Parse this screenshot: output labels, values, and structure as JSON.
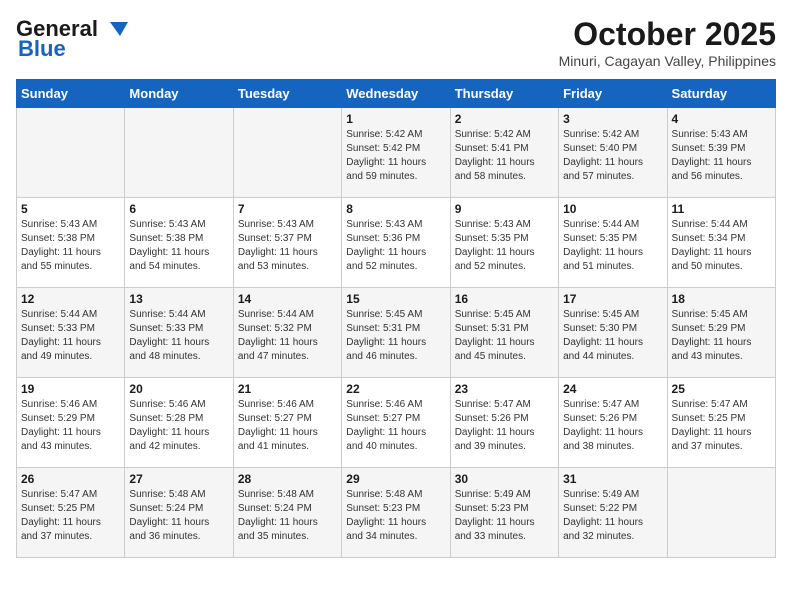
{
  "header": {
    "logo_line1": "General",
    "logo_line2": "Blue",
    "month": "October 2025",
    "location": "Minuri, Cagayan Valley, Philippines"
  },
  "columns": [
    "Sunday",
    "Monday",
    "Tuesday",
    "Wednesday",
    "Thursday",
    "Friday",
    "Saturday"
  ],
  "weeks": [
    [
      {
        "day": "",
        "info": ""
      },
      {
        "day": "",
        "info": ""
      },
      {
        "day": "",
        "info": ""
      },
      {
        "day": "1",
        "info": "Sunrise: 5:42 AM\nSunset: 5:42 PM\nDaylight: 11 hours\nand 59 minutes."
      },
      {
        "day": "2",
        "info": "Sunrise: 5:42 AM\nSunset: 5:41 PM\nDaylight: 11 hours\nand 58 minutes."
      },
      {
        "day": "3",
        "info": "Sunrise: 5:42 AM\nSunset: 5:40 PM\nDaylight: 11 hours\nand 57 minutes."
      },
      {
        "day": "4",
        "info": "Sunrise: 5:43 AM\nSunset: 5:39 PM\nDaylight: 11 hours\nand 56 minutes."
      }
    ],
    [
      {
        "day": "5",
        "info": "Sunrise: 5:43 AM\nSunset: 5:38 PM\nDaylight: 11 hours\nand 55 minutes."
      },
      {
        "day": "6",
        "info": "Sunrise: 5:43 AM\nSunset: 5:38 PM\nDaylight: 11 hours\nand 54 minutes."
      },
      {
        "day": "7",
        "info": "Sunrise: 5:43 AM\nSunset: 5:37 PM\nDaylight: 11 hours\nand 53 minutes."
      },
      {
        "day": "8",
        "info": "Sunrise: 5:43 AM\nSunset: 5:36 PM\nDaylight: 11 hours\nand 52 minutes."
      },
      {
        "day": "9",
        "info": "Sunrise: 5:43 AM\nSunset: 5:35 PM\nDaylight: 11 hours\nand 52 minutes."
      },
      {
        "day": "10",
        "info": "Sunrise: 5:44 AM\nSunset: 5:35 PM\nDaylight: 11 hours\nand 51 minutes."
      },
      {
        "day": "11",
        "info": "Sunrise: 5:44 AM\nSunset: 5:34 PM\nDaylight: 11 hours\nand 50 minutes."
      }
    ],
    [
      {
        "day": "12",
        "info": "Sunrise: 5:44 AM\nSunset: 5:33 PM\nDaylight: 11 hours\nand 49 minutes."
      },
      {
        "day": "13",
        "info": "Sunrise: 5:44 AM\nSunset: 5:33 PM\nDaylight: 11 hours\nand 48 minutes."
      },
      {
        "day": "14",
        "info": "Sunrise: 5:44 AM\nSunset: 5:32 PM\nDaylight: 11 hours\nand 47 minutes."
      },
      {
        "day": "15",
        "info": "Sunrise: 5:45 AM\nSunset: 5:31 PM\nDaylight: 11 hours\nand 46 minutes."
      },
      {
        "day": "16",
        "info": "Sunrise: 5:45 AM\nSunset: 5:31 PM\nDaylight: 11 hours\nand 45 minutes."
      },
      {
        "day": "17",
        "info": "Sunrise: 5:45 AM\nSunset: 5:30 PM\nDaylight: 11 hours\nand 44 minutes."
      },
      {
        "day": "18",
        "info": "Sunrise: 5:45 AM\nSunset: 5:29 PM\nDaylight: 11 hours\nand 43 minutes."
      }
    ],
    [
      {
        "day": "19",
        "info": "Sunrise: 5:46 AM\nSunset: 5:29 PM\nDaylight: 11 hours\nand 43 minutes."
      },
      {
        "day": "20",
        "info": "Sunrise: 5:46 AM\nSunset: 5:28 PM\nDaylight: 11 hours\nand 42 minutes."
      },
      {
        "day": "21",
        "info": "Sunrise: 5:46 AM\nSunset: 5:27 PM\nDaylight: 11 hours\nand 41 minutes."
      },
      {
        "day": "22",
        "info": "Sunrise: 5:46 AM\nSunset: 5:27 PM\nDaylight: 11 hours\nand 40 minutes."
      },
      {
        "day": "23",
        "info": "Sunrise: 5:47 AM\nSunset: 5:26 PM\nDaylight: 11 hours\nand 39 minutes."
      },
      {
        "day": "24",
        "info": "Sunrise: 5:47 AM\nSunset: 5:26 PM\nDaylight: 11 hours\nand 38 minutes."
      },
      {
        "day": "25",
        "info": "Sunrise: 5:47 AM\nSunset: 5:25 PM\nDaylight: 11 hours\nand 37 minutes."
      }
    ],
    [
      {
        "day": "26",
        "info": "Sunrise: 5:47 AM\nSunset: 5:25 PM\nDaylight: 11 hours\nand 37 minutes."
      },
      {
        "day": "27",
        "info": "Sunrise: 5:48 AM\nSunset: 5:24 PM\nDaylight: 11 hours\nand 36 minutes."
      },
      {
        "day": "28",
        "info": "Sunrise: 5:48 AM\nSunset: 5:24 PM\nDaylight: 11 hours\nand 35 minutes."
      },
      {
        "day": "29",
        "info": "Sunrise: 5:48 AM\nSunset: 5:23 PM\nDaylight: 11 hours\nand 34 minutes."
      },
      {
        "day": "30",
        "info": "Sunrise: 5:49 AM\nSunset: 5:23 PM\nDaylight: 11 hours\nand 33 minutes."
      },
      {
        "day": "31",
        "info": "Sunrise: 5:49 AM\nSunset: 5:22 PM\nDaylight: 11 hours\nand 32 minutes."
      },
      {
        "day": "",
        "info": ""
      }
    ]
  ]
}
